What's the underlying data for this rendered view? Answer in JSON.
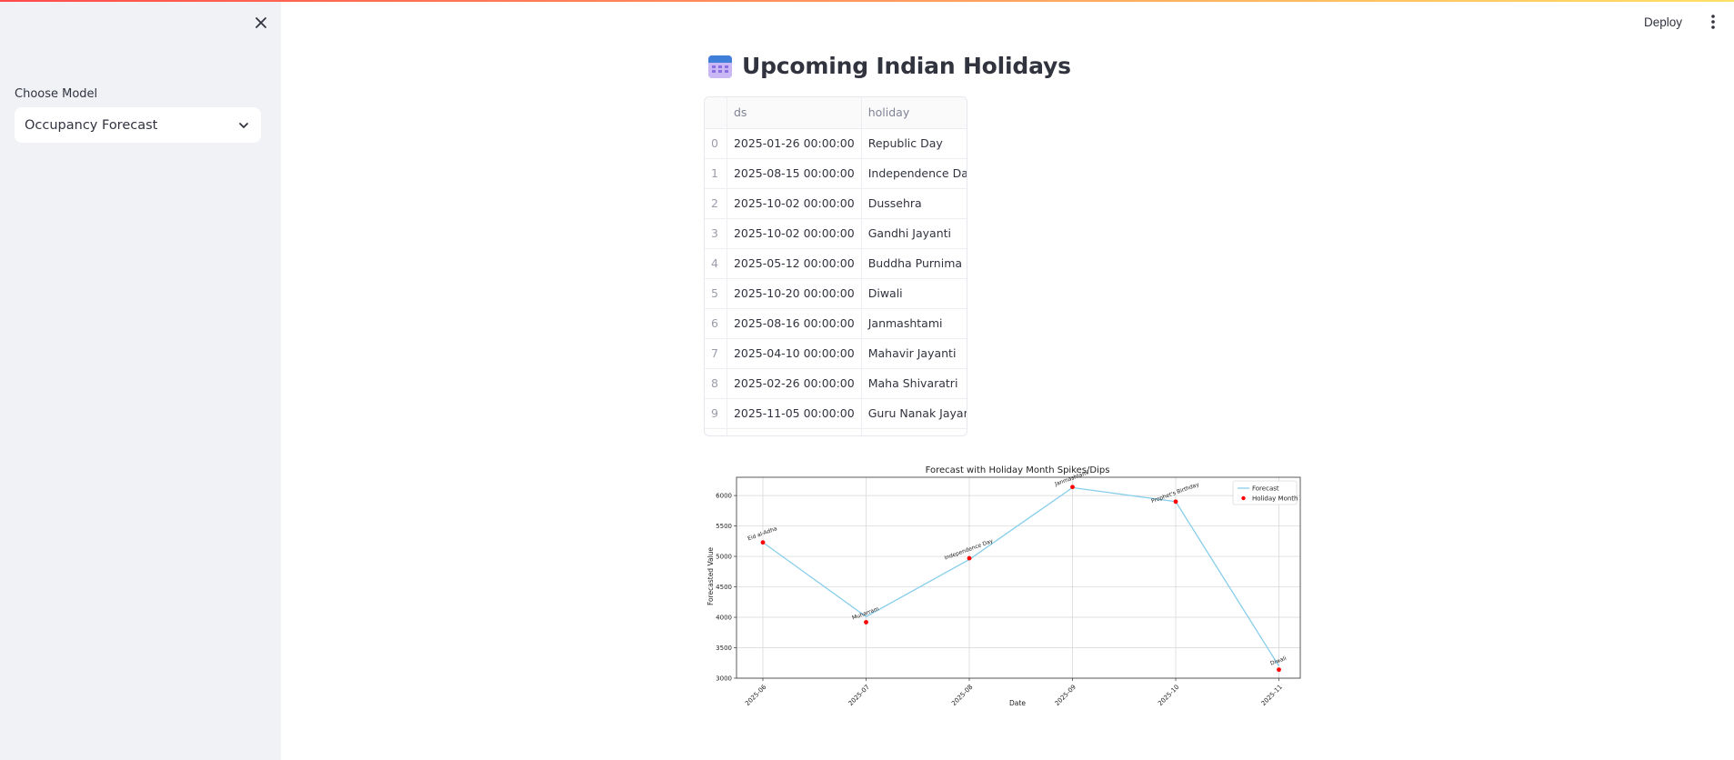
{
  "sidebar": {
    "close_icon": "close-icon",
    "choose_label": "Choose Model",
    "selected_model": "Occupancy Forecast",
    "dropdown_icon": "chevron-down-icon"
  },
  "header": {
    "deploy_label": "Deploy",
    "menu_icon": "kebab-menu-icon"
  },
  "main": {
    "title_icon": "calendar-icon",
    "title": "Upcoming Indian Holidays",
    "table": {
      "columns": [
        "",
        "ds",
        "holiday"
      ],
      "rows": [
        {
          "index": "0",
          "ds": "2025-01-26 00:00:00",
          "holiday": "Republic Day"
        },
        {
          "index": "1",
          "ds": "2025-08-15 00:00:00",
          "holiday": "Independence Day"
        },
        {
          "index": "2",
          "ds": "2025-10-02 00:00:00",
          "holiday": "Dussehra"
        },
        {
          "index": "3",
          "ds": "2025-10-02 00:00:00",
          "holiday": "Gandhi Jayanti"
        },
        {
          "index": "4",
          "ds": "2025-05-12 00:00:00",
          "holiday": "Buddha Purnima"
        },
        {
          "index": "5",
          "ds": "2025-10-20 00:00:00",
          "holiday": "Diwali"
        },
        {
          "index": "6",
          "ds": "2025-08-16 00:00:00",
          "holiday": "Janmashtami"
        },
        {
          "index": "7",
          "ds": "2025-04-10 00:00:00",
          "holiday": "Mahavir Jayanti"
        },
        {
          "index": "8",
          "ds": "2025-02-26 00:00:00",
          "holiday": "Maha Shivaratri"
        },
        {
          "index": "9",
          "ds": "2025-11-05 00:00:00",
          "holiday": "Guru Nanak Jayanti"
        }
      ]
    }
  },
  "chart_data": {
    "type": "line",
    "title": "Forecast with Holiday Month Spikes/Dips",
    "xlabel": "Date",
    "ylabel": "Forecasted Value",
    "categories": [
      "2025-06",
      "2025-07",
      "2025-08",
      "2025-09",
      "2025-10",
      "2025-11"
    ],
    "series": [
      {
        "name": "Forecast",
        "color": "#87ceeb",
        "values": [
          5230,
          4010,
          4950,
          6130,
          5900,
          3200
        ]
      },
      {
        "name": "Holiday Month",
        "color": "#ff0000",
        "values": [
          5230,
          3920,
          4970,
          6140,
          5900,
          3140
        ]
      }
    ],
    "annotations": [
      "Eid al-Adha",
      "Muharram",
      "Independence Day",
      "Janmashtami",
      "Prophet's Birthday",
      "Diwali"
    ],
    "yticks": [
      3000,
      3500,
      4000,
      4500,
      5000,
      5500,
      6000
    ],
    "ylim": [
      3000,
      6300
    ],
    "grid": true,
    "legend_position": "top-right"
  }
}
